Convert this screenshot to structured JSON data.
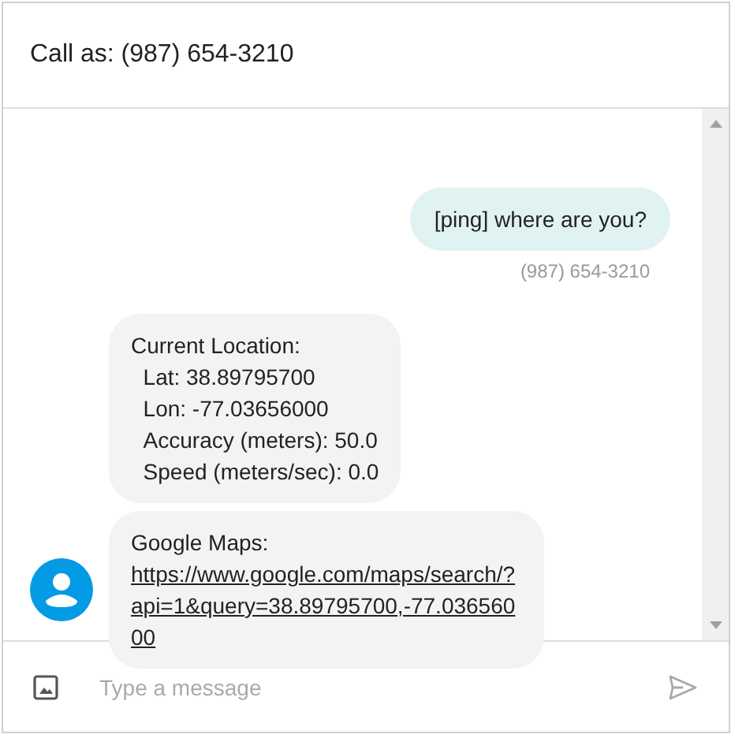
{
  "header": {
    "title": "Call as: (987) 654-3210"
  },
  "messages": [
    {
      "kind": "outgoing",
      "text": "[ping] where are you?",
      "sender": "(987) 654-3210"
    },
    {
      "kind": "incoming",
      "text": "Current Location:\n  Lat: 38.89795700\n  Lon: -77.03656000\n  Accuracy (meters): 50.0\n  Speed (meters/sec): 0.0",
      "avatar": false
    },
    {
      "kind": "incoming",
      "text": "Google Maps:",
      "link": "https://www.google.com/maps/search/?api=1&query=38.89795700,-77.03656000",
      "avatar": true
    }
  ],
  "composer": {
    "placeholder": "Type a message"
  }
}
